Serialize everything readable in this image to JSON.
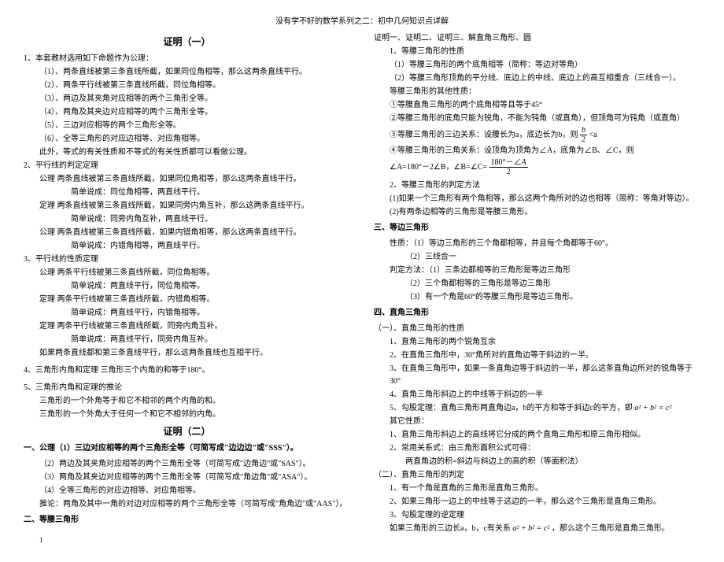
{
  "header": "没有学不好的数学系列之二：初中几何知识点详解",
  "title1": "证明（一）",
  "title2": "证明（二）",
  "left": {
    "l1": "1、本套教材选用如下命题作为公理：",
    "l1a": "（1）、两条直线被第三条直线所截，如果同位角相等，那么这两条直线平行。",
    "l1b": "（2）、两条平行线被第三条直线所截，同位角相等。",
    "l1c": "（3）、两边及其夹角对应相等的两个三角形全等。",
    "l1d": "（4）、两角及其夹边对应相等的两个三角形全等。",
    "l1e": "（5）、三边对应相等的两个三角形全等。",
    "l1f": "（6）、全等三角形的对应边相等、对应角相等。",
    "l1g": "此外，等式的有关性质和不等式的有关性质都可以看做公理。",
    "l2": "2、平行线的判定定理",
    "l2a": "公理  两条直线被第三条直线所截，如果同位角相等，那么这两条直线平行。",
    "l2a2": "简单说成：同位角相等，两直线平行。",
    "l2b": "定理  两条直线被第三条直线所截，如果同旁内角互补，那么这两条直线平行。",
    "l2b2": "简单说成：同旁内角互补，两直线平行。",
    "l2c": "公理  两条直线被第三条直线所截，如果内错角相等，那么这两条直线平行。",
    "l2c2": "简单说成：内错角相等，两直线平行。",
    "l3": "3、平行线的性质定理",
    "l3a": "公理  两条平行线被第三条直线所截，同位角相等。",
    "l3a2": "简单说成：两直线平行，同位角相等。",
    "l3b": "定理  两条平行线被第三条直线所截，内错角相等。",
    "l3b2": "简单说成：两直线平行，内错角相等。",
    "l3c": "定理  两条平行线被第三条直线所截，同旁内角互补。",
    "l3c2": "简单说成：两直线平行，同旁内角互补。",
    "l3d": "如果两条直线都和第三条直线平行，那么这两条直线也互相平行。",
    "l4": "4、三角形内角和定理  三角形三个内角的和等于180°。",
    "l5": "5、三角形内角和定理的推论",
    "l5a": "三角形的一个外角等于和它不相邻的两个内角的和。",
    "l5b": "三角形的一个外角大于任何一个和它不相邻的内角。",
    "s1": "一、公理（1）三边对应相等的两个三角形全等（可简写成\"边边边\"或\"SSS\"）。",
    "s1b": "（2）两边及其夹角对应相等的两个三角形全等（可简写成\"边角边\"或\"SAS\"）。",
    "s1c": "（3）两角及其夹边对应相等的两个三角形全等（可简写成\"角边角\"或\"ASA\"）。",
    "s1d": "（4）全等三角形的对应边相等、对应角相等。",
    "s1e": "推论：两角及其中一角的对边对应相等的两个三角形全等（可简写成\"角角边\"或\"AAS\"）。",
    "s2": "二、等腰三角形"
  },
  "right": {
    "r0": "证明一、证明二、证明三、解直角三角形、圆",
    "r1": "1、等腰三角形的性质",
    "r1a": "（1）等腰三角形的两个底角相等（简称：等边对等角）",
    "r1b": "（2）等腰三角形顶角的平分线、底边上的中线、底边上的高互相重合（三线合一）。",
    "r1c": "等腰三角形的其他性质：",
    "r1d": "①等腰直角三角形的两个底角相等且等于45°",
    "r1e": "②等腰三角形的底角只能为锐角，不能为钝角（或直角），但顶角可为钝角（或直角）",
    "r1f_prefix": "③等腰三角形的三边关系：设腰长为a，底边长为b，则",
    "r1f_suffix": "<a",
    "r1g": "④等腰三角形的三角关系：设顶角为顶角为∠A，底角为∠B、∠C，则",
    "r1h_prefix": "∠A=180°－2∠B，∠B=∠C=",
    "r2": "2、等腰三角形的判定方法",
    "r2a": "(1)如果一个三角形有两个角相等，那么这两个角所对的边也相等（简称：等角对等边）。",
    "r2b": "(2)有两条边相等的三角形是等腰三角形。",
    "r3": "三、等边三角形",
    "r3a": "性质：（1）等边三角形的三个角都相等，并且每个角都等于60°。",
    "r3b": "（2）三线合一",
    "r3c": "判定方法：（1）三条边都相等的三角形是等边三角形",
    "r3d": "（2）三个角都相等的三角形是等边三角形",
    "r3e": "（3）有一个角是60°的等腰三角形是等边三角形。",
    "r4": "四、直角三角形",
    "r4a": "（一）、直角三角形的性质",
    "r4b": "1、直角三角形的两个锐角互余",
    "r4c": "2、在直角三角形中，30°角所对的直角边等于斜边的一半。",
    "r4d": "3、在直角三角形中，如果一条直角边等于斜边的一半，那么这条直角边所对的锐角等于30°",
    "r4e": "4、直角三角形斜边上的中线等于斜边的一半",
    "r4f_prefix": "5、勾股定理：直角三角形两直角边a，b的平方和等于斜边c的平方，即",
    "r4f_formula": "a² + b² = c²",
    "r4g": "其它性质：",
    "r4h": "1、直角三角形斜边上的高线将它分成的两个直角三角形和原三角形相似。",
    "r4i": "2、常用关系式：由三角形面积公式可得：",
    "r4j": "两直角边的积=斜边与斜边上的高的积（等面积法）",
    "r5": "（二）、直角三角形的判定",
    "r5a": "1、有一个角是直角的三角形是直角三角形。",
    "r5b": "2、如果三角形一边上的中线等于这边的一半，那么这个三角形是直角三角形。",
    "r5c": "3、勾股定理的逆定理",
    "r5d_prefix": "如果三角形的三边长a，b，c有关系",
    "r5d_formula": "a² + b² = c²",
    "r5d_suffix": "，那么这个三角形是直角三角形。"
  },
  "page_num": "1"
}
